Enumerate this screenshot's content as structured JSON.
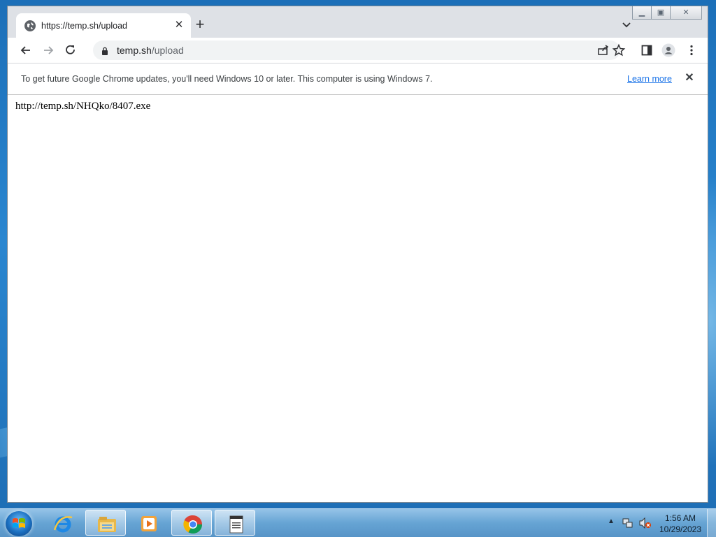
{
  "browser": {
    "tab": {
      "title": "https://temp.sh/upload",
      "close_glyph": "✕"
    },
    "new_tab_glyph": "+",
    "omnibox": {
      "domain": "temp.sh",
      "path": "/upload"
    },
    "caption": {
      "minimize": "▁",
      "maximize": "▣",
      "close": "✕"
    }
  },
  "infobar": {
    "message": "To get future Google Chrome updates, you'll need Windows 10 or later. This computer is using Windows 7.",
    "link": "Learn more",
    "close_glyph": "✕"
  },
  "page": {
    "text": "http://temp.sh/NHQko/8407.exe"
  },
  "taskbar": {
    "items": [
      "start-orb-icon",
      "internet-explorer-icon",
      "file-explorer-icon",
      "media-player-icon",
      "chrome-icon",
      "notepad-icon"
    ],
    "tray_arrow": "▲",
    "clock": {
      "time": "1:56 AM",
      "date": "10/29/2023"
    }
  },
  "colors": {
    "accent": "#1a73e8",
    "tab_bar": "#dee1e6",
    "toolbar": "#ffffff"
  }
}
